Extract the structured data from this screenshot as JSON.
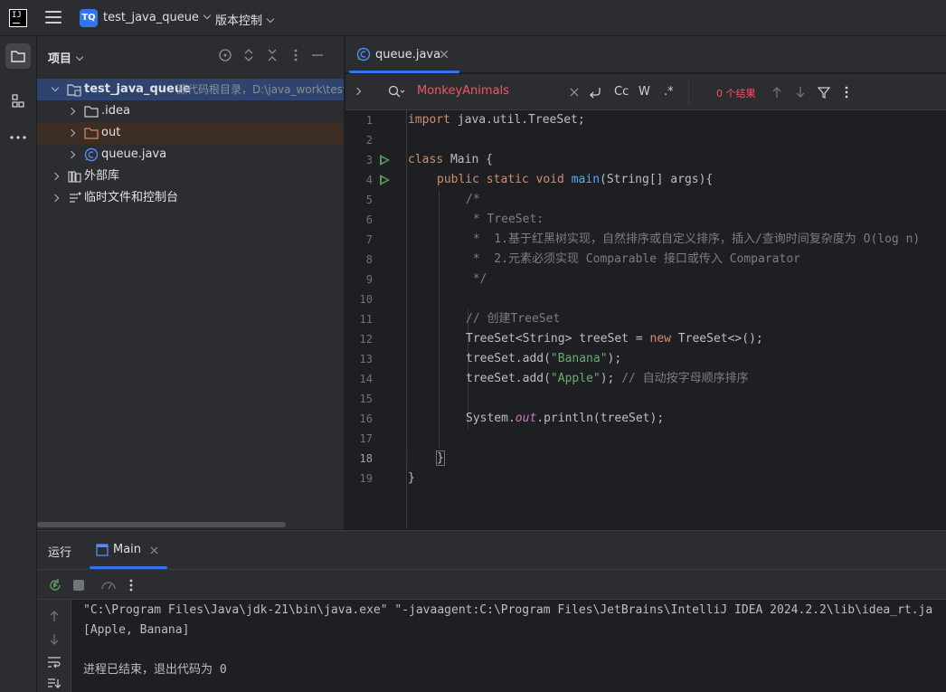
{
  "titlebar": {
    "app_logo_text": "IJ",
    "project_badge": "TQ",
    "project_name": "test_java_queue",
    "vcs_label": "版本控制"
  },
  "project_panel": {
    "title": "项目",
    "root": {
      "name": "test_java_queue",
      "hint": "源代码根目录，D:\\java_work\\test_"
    },
    "items": [
      {
        "label": ".idea",
        "icon": "folder-icon"
      },
      {
        "label": "out",
        "icon": "folder-icon"
      },
      {
        "label": "queue.java",
        "icon": "java-class-icon"
      }
    ],
    "external_libs": "外部库",
    "scratches": "临时文件和控制台"
  },
  "editor": {
    "tab_label": "queue.java",
    "find": {
      "query": "MonkeyAnimals",
      "case_label": "Cc",
      "word_label": "W",
      "regex_label": ".*",
      "results": "0 个结果"
    },
    "line_numbers": [
      "1",
      "2",
      "3",
      "4",
      "5",
      "6",
      "7",
      "8",
      "9",
      "10",
      "11",
      "12",
      "13",
      "14",
      "15",
      "16",
      "17",
      "18",
      "19"
    ],
    "current_line": "18",
    "code": {
      "l1_kw": "import",
      "l1_rest": " java.util.TreeSet;",
      "l3_kw": "class",
      "l3_rest": " Main {",
      "l4_kw": "public static void",
      "l4_fn": "main",
      "l4_rest": "(String[] args){",
      "l5": "/*",
      "l6": " * TreeSet:",
      "l7": " *  1.基于红黑树实现，自然排序或自定义排序，插入/查询时间复杂度为 O(log n)",
      "l8": " *  2.元素必须实现 Comparable 接口或传入 Comparator",
      "l9": " */",
      "l11": "// 创建TreeSet",
      "l12_a": "TreeSet<String> treeSet = ",
      "l12_kw": "new",
      "l12_b": " TreeSet<>();",
      "l13_a": "treeSet.add(",
      "l13_str": "\"Banana\"",
      "l13_b": ");",
      "l14_a": "treeSet.add(",
      "l14_str": "\"Apple\"",
      "l14_b": "); ",
      "l14_cmt": "// 自动按字母顺序排序",
      "l16_a": "System.",
      "l16_static": "out",
      "l16_b": ".println(treeSet);",
      "l18": "}",
      "l19": "}"
    }
  },
  "run_panel": {
    "title": "运行",
    "tab_label": "Main",
    "output": [
      "\"C:\\Program Files\\Java\\jdk-21\\bin\\java.exe\" \"-javaagent:C:\\Program Files\\JetBrains\\IntelliJ IDEA 2024.2.2\\lib\\idea_rt.ja",
      "[Apple, Banana]",
      "",
      "进程已结束，退出代码为 0"
    ]
  },
  "colors": {
    "accent": "#3574f0",
    "run_green": "#57965c",
    "search_red": "#f75464"
  }
}
